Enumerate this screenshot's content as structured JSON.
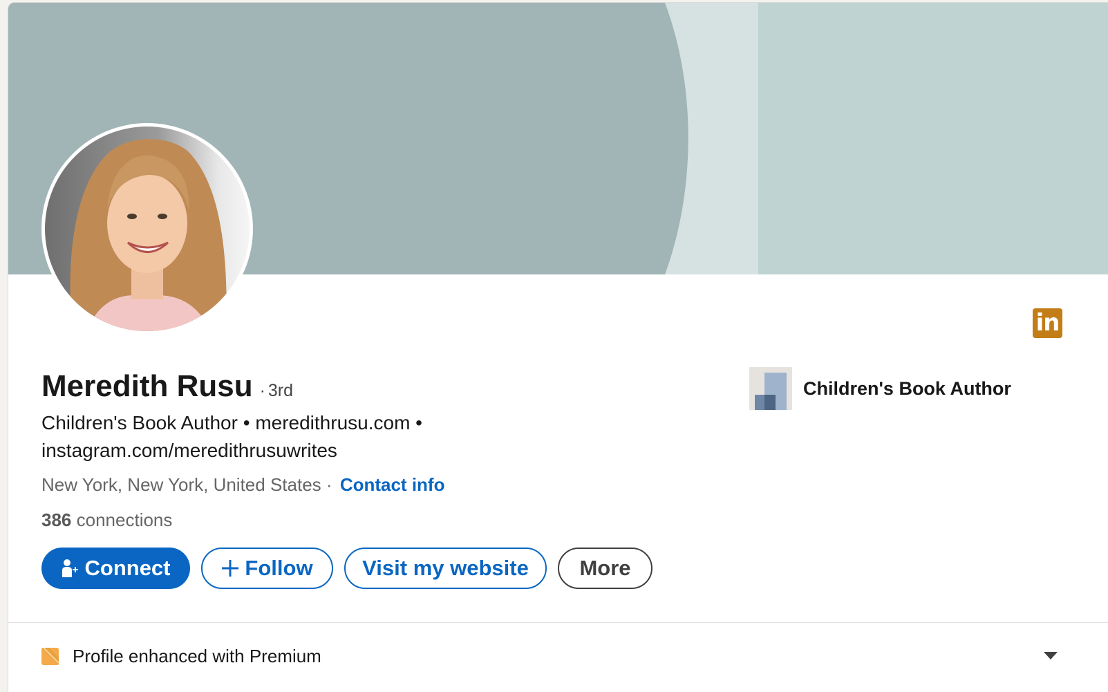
{
  "profile": {
    "name": "Meredith Rusu",
    "degree_separator": "·",
    "degree": "3rd",
    "headline": "Children's Book Author • meredithrusu.com • instagram.com/meredithrusuwrites",
    "location": "New York, New York, United States",
    "location_separator": "·",
    "contact_info_label": "Contact info",
    "connections_count": "386",
    "connections_label": "connections"
  },
  "actions": {
    "connect_label": "Connect",
    "follow_label": "Follow",
    "website_label": "Visit my website",
    "more_label": "More"
  },
  "current_position": {
    "company_name": "Children's Book Author"
  },
  "badge": {
    "text": "in"
  },
  "premium": {
    "label": "Profile enhanced with Premium"
  },
  "colors": {
    "brand_blue": "#0a66c2",
    "banner_dark": "#a1b4b6",
    "banner_light": "#bfd3d3",
    "premium_gold": "#c37d16"
  },
  "icons": {
    "connect": "person-add-icon",
    "follow": "plus-icon",
    "premium": "premium-badge-icon",
    "caret": "chevron-down-icon",
    "badge": "linkedin-logo-icon"
  }
}
